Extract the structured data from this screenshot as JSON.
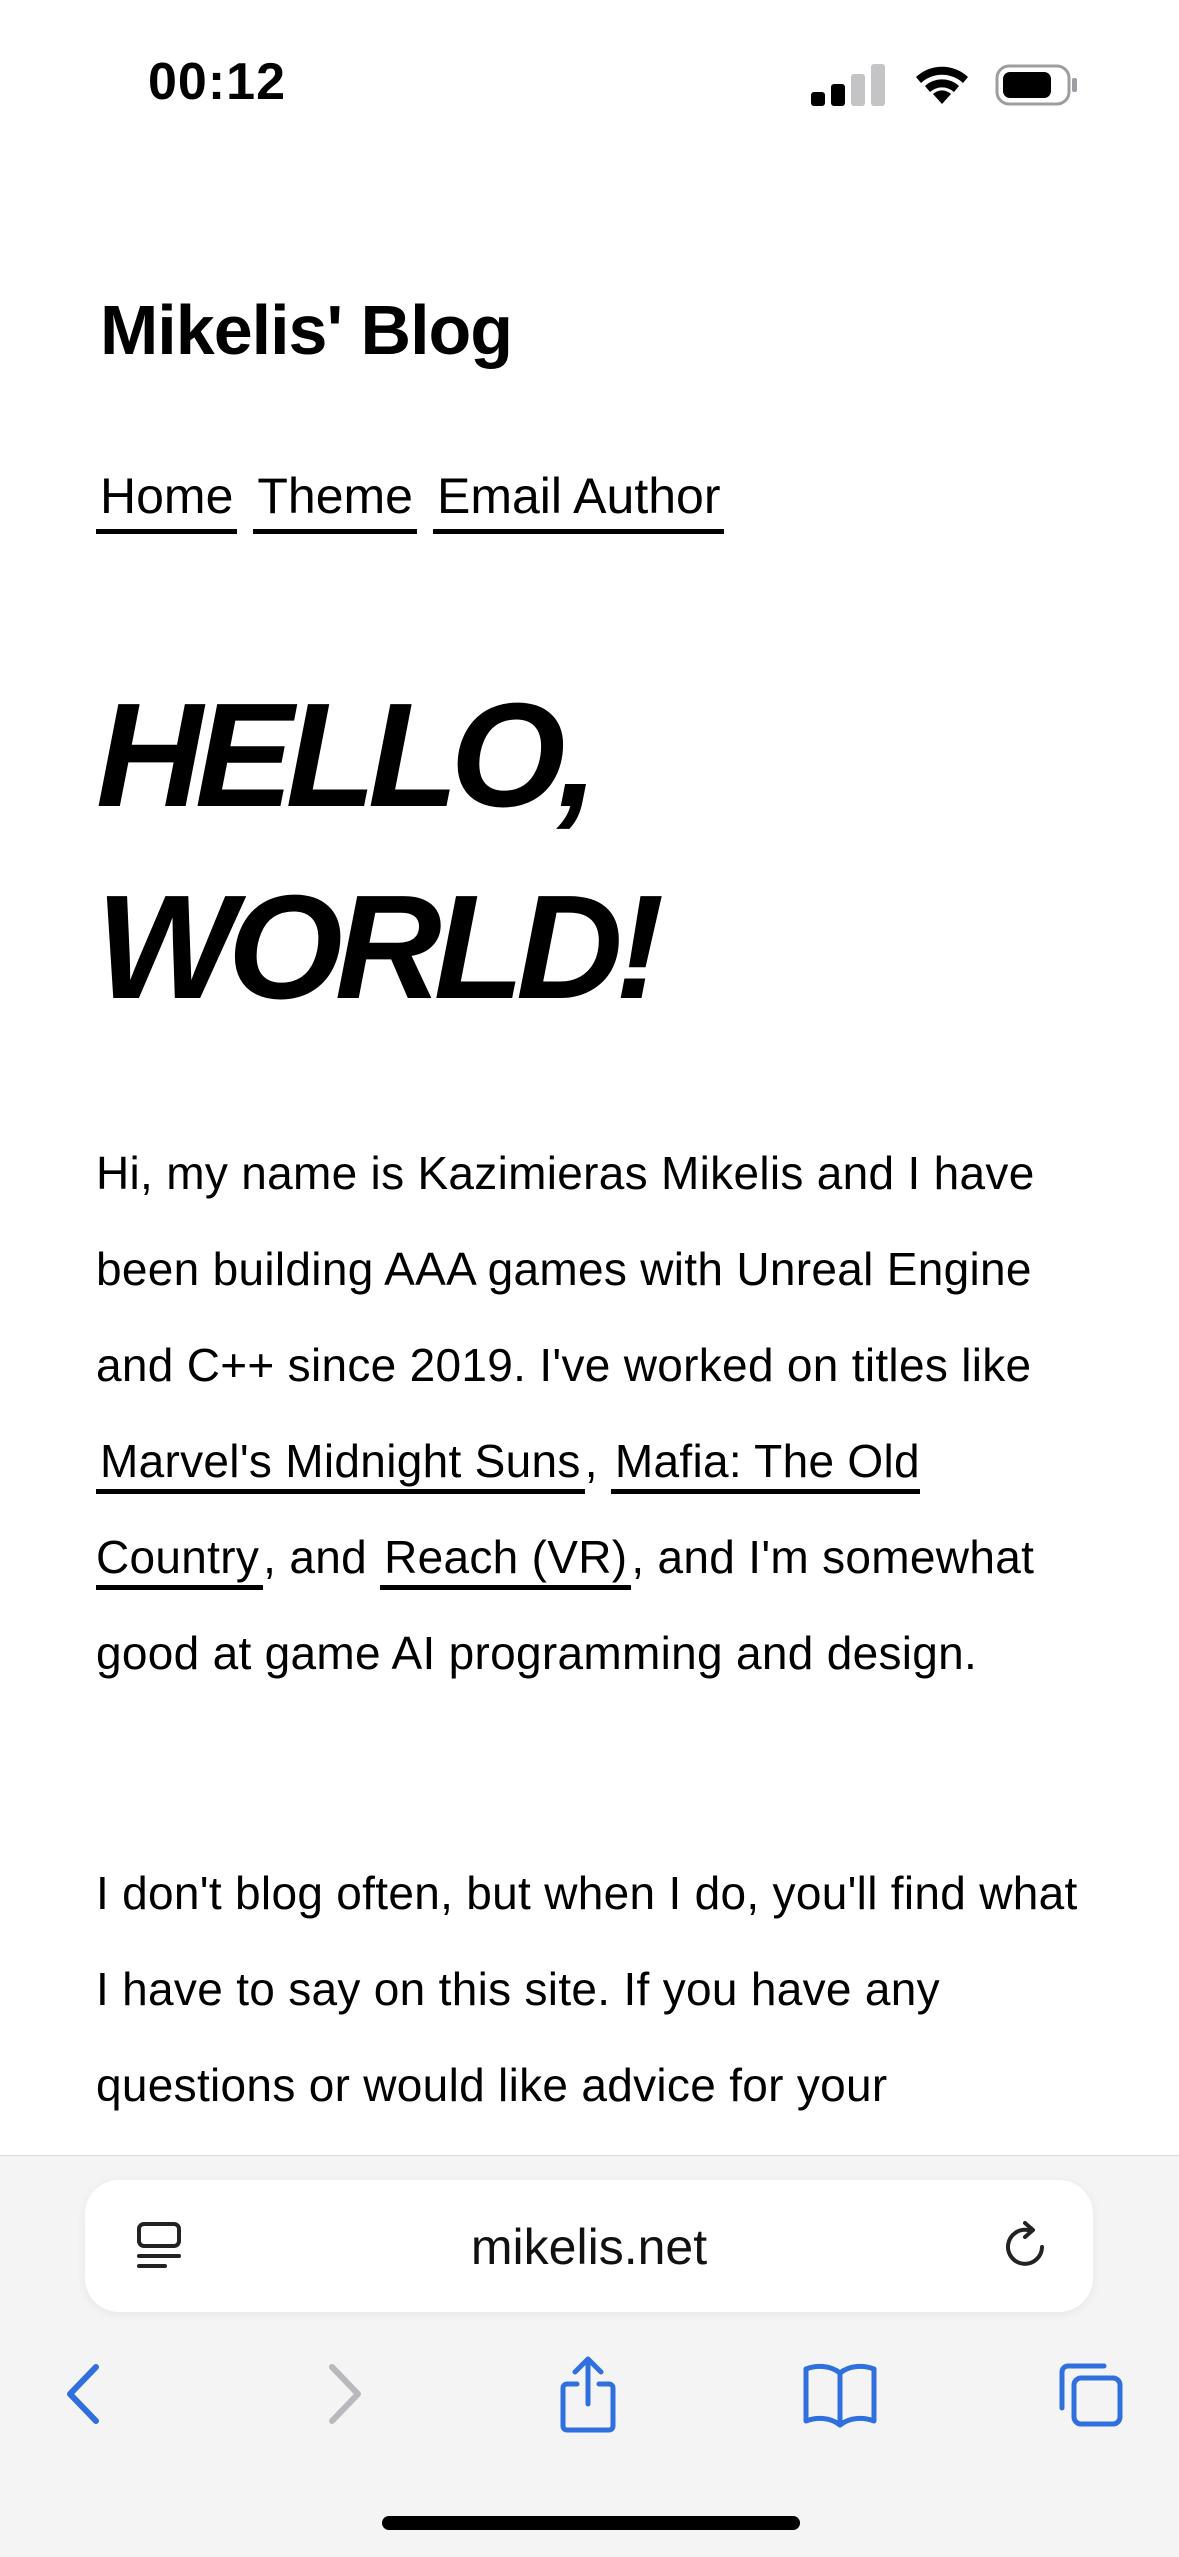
{
  "status_bar": {
    "time": "00:12"
  },
  "blog": {
    "title": "Mikelis' Blog",
    "nav": [
      "Home",
      "Theme",
      "Email Author"
    ],
    "hero_line1": "HELLO,",
    "hero_line2": "WORLD!",
    "para1": {
      "text1": "Hi, my name is Kazimieras Mikelis and I have been building AAA games with Unreal Engine and C++ since 2019. I've worked on titles like ",
      "link1": "Marvel's Midnight Suns",
      "text2": ", ",
      "link2": "Mafia: The Old Country",
      "text3": ", and ",
      "link3": "Reach (VR)",
      "text4": ", and I'm somewhat good at game AI programming and design."
    },
    "para2": "I don't blog often, but when I do, you'll find what I have to say on this site. If you have any questions or would like advice for your"
  },
  "browser": {
    "url": "mikelis.net",
    "accent_color": "#2f6fde",
    "disabled_color": "#b8b8bd"
  }
}
